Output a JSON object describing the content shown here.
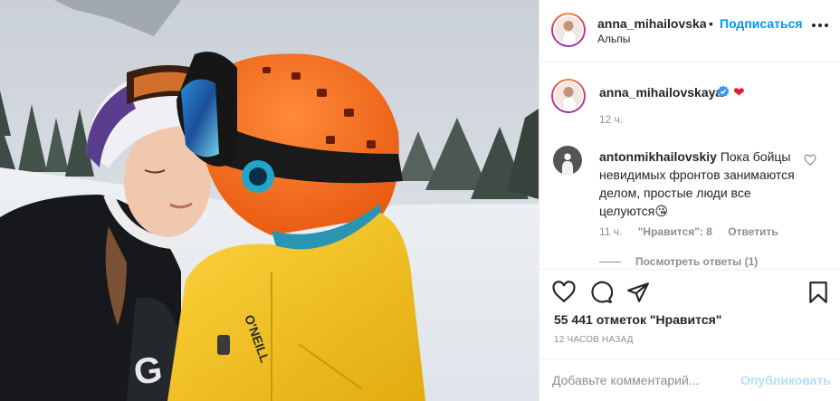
{
  "post": {
    "image_alt": "Два человека в горнолыжных шлемах на снежном склоне",
    "colors": {
      "helmet": "#ff6a1a",
      "jacket": "#f4c21c",
      "accent_link": "#0095f6"
    }
  },
  "header": {
    "username": "anna_mihailovskaya",
    "separator": "•",
    "follow_label": "Подписаться",
    "location": "Альпы",
    "more_icon": "more-horizontal-icon"
  },
  "caption": {
    "username": "anna_mihailovskaya",
    "emoji": "❤",
    "time": "12 ч."
  },
  "comment": {
    "username": "antonmikhailovskiy",
    "text": "Пока бойцы невидимых фронтов занимаются делом, простые люди все целуются",
    "emoji": "😘",
    "time": "11 ч.",
    "likes": "\"Нравится\": 8",
    "reply_label": "Ответить",
    "view_replies": "Посмотреть ответы (1)"
  },
  "actions": {
    "like_icon": "heart-icon",
    "comment_icon": "comment-icon",
    "share_icon": "share-icon",
    "save_icon": "bookmark-icon"
  },
  "stats": {
    "likes_total": "55 441 отметок \"Нравится\"",
    "posted_ago": "12 ЧАСОВ НАЗАД"
  },
  "composer": {
    "placeholder": "Добавьте комментарий...",
    "publish_label": "Опубликовать"
  }
}
